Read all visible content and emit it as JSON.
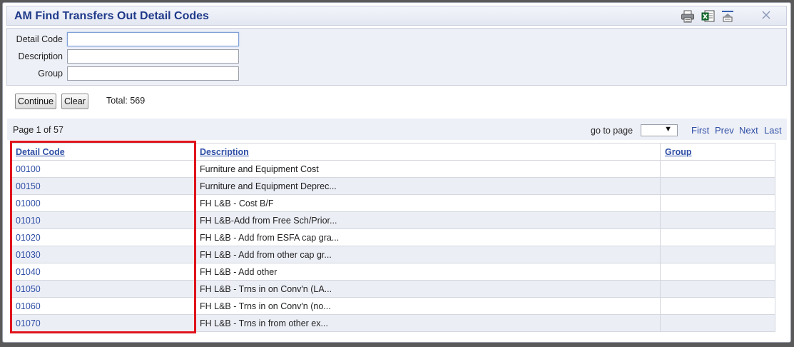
{
  "dialog": {
    "title": "AM Find Transfers Out Detail Codes",
    "toolbar": [
      "printer-icon",
      "excel-export-icon",
      "collapse-panel-icon",
      "close-icon"
    ]
  },
  "search": {
    "fields": [
      {
        "label": "Detail Code",
        "value": ""
      },
      {
        "label": "Description",
        "value": ""
      },
      {
        "label": "Group",
        "value": ""
      }
    ],
    "continue_label": "Continue",
    "clear_label": "Clear",
    "total_text": "Total: 569"
  },
  "pager": {
    "page_text": "Page 1 of 57",
    "goto_label": "go to page",
    "goto_selected": "",
    "first": "First",
    "prev": "Prev",
    "next": "Next",
    "last": "Last"
  },
  "table": {
    "headers": [
      "Detail Code",
      "Description",
      "Group"
    ],
    "rows": [
      {
        "code": "00100",
        "description": "Furniture and Equipment Cost",
        "group": ""
      },
      {
        "code": "00150",
        "description": "Furniture and Equipment Deprec...",
        "group": ""
      },
      {
        "code": "01000",
        "description": "FH L&B - Cost B/F",
        "group": ""
      },
      {
        "code": "01010",
        "description": "FH L&B-Add from Free Sch/Prior...",
        "group": ""
      },
      {
        "code": "01020",
        "description": "FH L&B - Add from ESFA cap gra...",
        "group": ""
      },
      {
        "code": "01030",
        "description": "FH L&B - Add from other cap gr...",
        "group": ""
      },
      {
        "code": "01040",
        "description": "FH L&B - Add other",
        "group": ""
      },
      {
        "code": "01050",
        "description": "FH L&B - Trns in on Conv'n (LA...",
        "group": ""
      },
      {
        "code": "01060",
        "description": "FH L&B - Trns in on Conv'n (no...",
        "group": ""
      },
      {
        "code": "01070",
        "description": "FH L&B - Trns in from other ex...",
        "group": ""
      }
    ]
  },
  "colors": {
    "link": "#2f4fa6",
    "title": "#1f3a8a",
    "panel_bg": "#eef0f7",
    "alt_row": "#eceef6",
    "highlight": "#e0131b"
  }
}
